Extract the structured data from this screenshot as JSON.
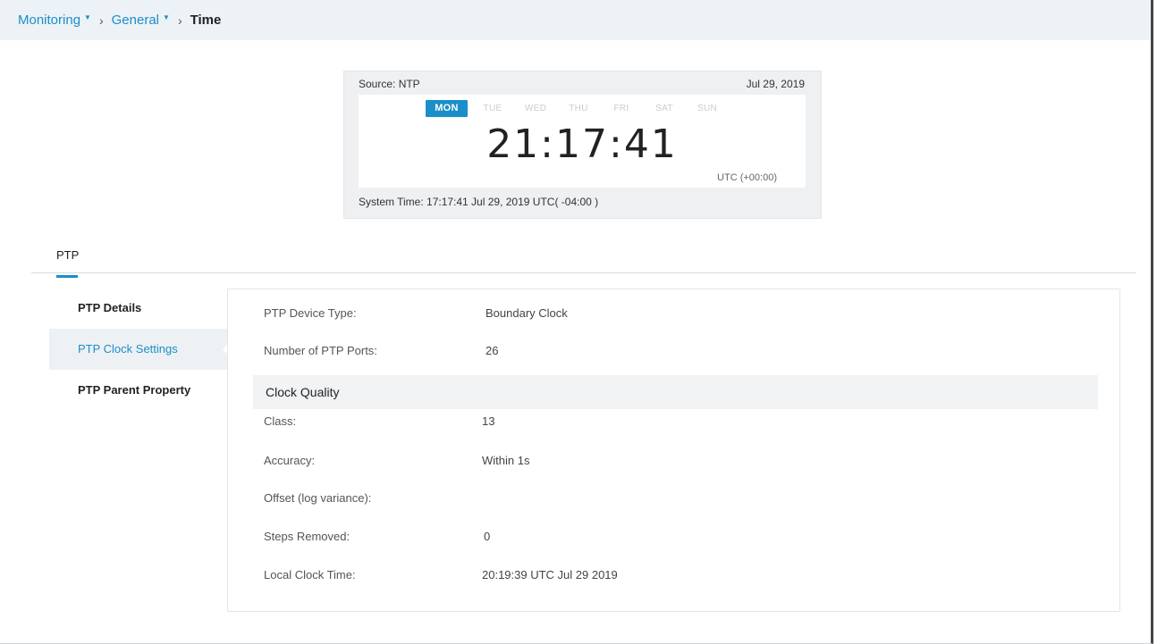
{
  "breadcrumb": {
    "items": [
      "Monitoring",
      "General"
    ],
    "current": "Time"
  },
  "clock": {
    "source": "Source: NTP",
    "date": "Jul 29, 2019",
    "days": [
      "MON",
      "TUE",
      "WED",
      "THU",
      "FRI",
      "SAT",
      "SUN"
    ],
    "active_day": "MON",
    "time": "21:17:41",
    "timezone": "UTC (+00:00)",
    "system_time": "System Time: 17:17:41 Jul 29, 2019 UTC( -04:00 )"
  },
  "tabs": [
    {
      "label": "PTP",
      "active": true
    }
  ],
  "side_menu": {
    "items": [
      {
        "label": "PTP Details",
        "active": false
      },
      {
        "label": "PTP Clock Settings",
        "active": true
      },
      {
        "label": "PTP Parent Property",
        "active": false
      }
    ]
  },
  "details": {
    "device_type": {
      "label": "PTP Device Type:",
      "value": "Boundary Clock"
    },
    "num_ports": {
      "label": "Number of PTP Ports:",
      "value": "26"
    },
    "clock_quality_title": "Clock Quality",
    "class": {
      "label": "Class:",
      "value": "13"
    },
    "accuracy": {
      "label": "Accuracy:",
      "value": "Within 1s"
    },
    "offset": {
      "label": "Offset (log variance):",
      "value": ""
    },
    "steps_removed": {
      "label": "Steps Removed:",
      "value": "0"
    },
    "local_clock_time": {
      "label": "Local Clock Time:",
      "value": "20:19:39 UTC Jul 29 2019"
    }
  },
  "colors": {
    "accent": "#1a8fc9",
    "breadcrumb_bg": "#edf2f6",
    "card_bg": "#eef0f2"
  }
}
